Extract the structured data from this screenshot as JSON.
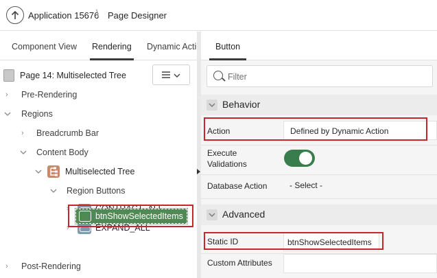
{
  "header": {
    "app_title": "Application 15676",
    "separator": "\\",
    "page_designer": "Page Designer"
  },
  "left_panel": {
    "tabs": [
      {
        "label": "Component View",
        "active": false
      },
      {
        "label": "Rendering",
        "active": true
      },
      {
        "label": "Dynamic Acti",
        "active": false
      }
    ],
    "page_title": "Page 14: Multiselected Tree",
    "tree": {
      "pre_rendering": "Pre-Rendering",
      "regions": "Regions",
      "breadcrumb_bar": "Breadcrumb Bar",
      "content_body": "Content Body",
      "multiselected_tree": "Multiselected Tree",
      "region_buttons": "Region Buttons",
      "contract_all": "CONTRACT_ALL",
      "expand_all": "EXPAND_ALL",
      "btn_show_selected": "btnShowSelectedItems",
      "post_rendering": "Post-Rendering"
    }
  },
  "right_panel": {
    "tab": "Button",
    "filter_placeholder": "Filter",
    "behavior": {
      "title": "Behavior",
      "action_label": "Action",
      "action_value": "Defined by Dynamic Action",
      "execute_validations_label_1": "Execute",
      "execute_validations_label_2": "Validations",
      "execute_validations_on": true,
      "database_action_label": "Database Action",
      "database_action_value": "- Select -"
    },
    "advanced": {
      "title": "Advanced",
      "static_id_label": "Static ID",
      "static_id_value": "btnShowSelectedItems",
      "custom_attributes_label": "Custom Attributes",
      "custom_attributes_value": ""
    }
  },
  "colors": {
    "highlight_red": "#c9252c",
    "selected_green": "#4f8a55",
    "toggle_green": "#3a7d4c",
    "region_icon": "#c98a69",
    "button_icon": "#7f9cae"
  }
}
